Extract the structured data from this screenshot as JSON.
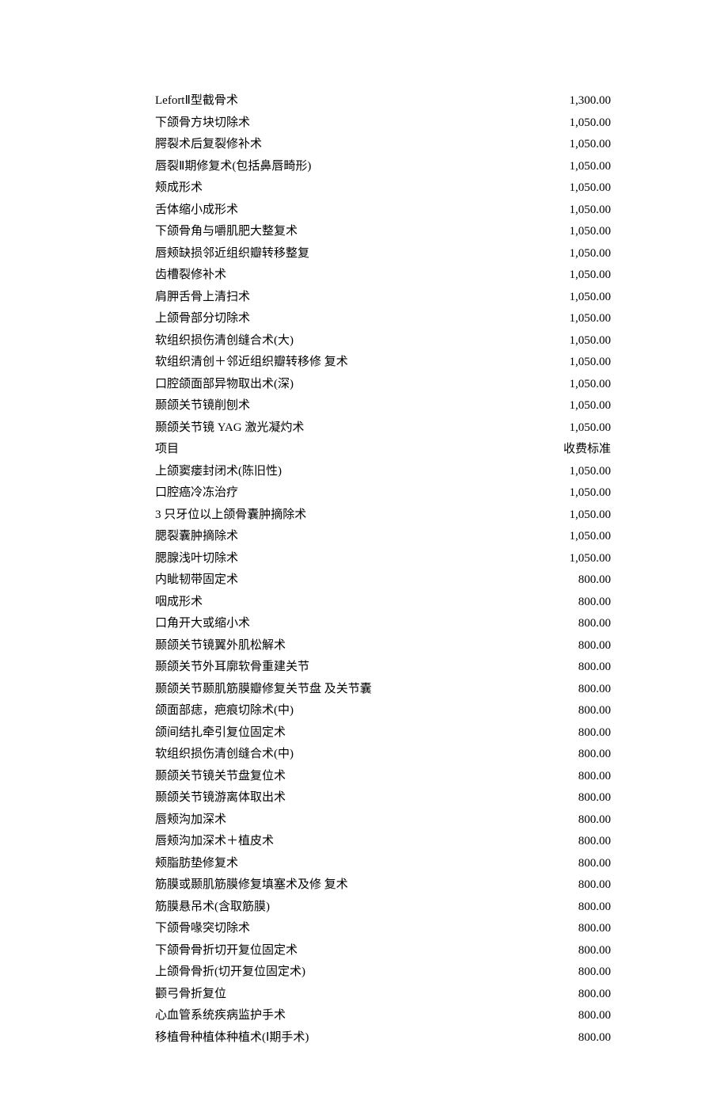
{
  "rows": [
    {
      "name": "LefortⅡ型截骨术",
      "price": "1,300.00"
    },
    {
      "name": "下颌骨方块切除术",
      "price": "1,050.00"
    },
    {
      "name": "腭裂术后复裂修补术",
      "price": "1,050.00"
    },
    {
      "name": "唇裂Ⅱ期修复术(包括鼻唇畸形)",
      "price": "1,050.00"
    },
    {
      "name": "颊成形术",
      "price": "1,050.00"
    },
    {
      "name": "舌体缩小成形术",
      "price": "1,050.00"
    },
    {
      "name": "下颌骨角与嚼肌肥大整复术",
      "price": "1,050.00"
    },
    {
      "name": "唇颊缺损邻近组织瓣转移整复",
      "price": "1,050.00"
    },
    {
      "name": "齿槽裂修补术",
      "price": "1,050.00"
    },
    {
      "name": "肩胛舌骨上清扫术",
      "price": "1,050.00"
    },
    {
      "name": "上颌骨部分切除术",
      "price": "1,050.00"
    },
    {
      "name": "软组织损伤清创缝合术(大)",
      "price": "1,050.00"
    },
    {
      "name": "软组织清创＋邻近组织瓣转移修  复术",
      "price": "1,050.00"
    },
    {
      "name": "口腔颌面部异物取出术(深)",
      "price": "1,050.00"
    },
    {
      "name": "颞颌关节镜削刨术",
      "price": "1,050.00"
    },
    {
      "name": "颞颌关节镜 YAG 激光凝灼术",
      "price": "1,050.00"
    },
    {
      "name": "项目",
      "price": "收费标准"
    },
    {
      "name": "上颌窦瘘封闭术(陈旧性)",
      "price": "1,050.00"
    },
    {
      "name": "口腔癌冷冻治疗",
      "price": "1,050.00"
    },
    {
      "name": "3 只牙位以上颌骨囊肿摘除术",
      "price": "1,050.00"
    },
    {
      "name": "腮裂囊肿摘除术",
      "price": "1,050.00"
    },
    {
      "name": "腮腺浅叶切除术",
      "price": "1,050.00"
    },
    {
      "name": "内眦韧带固定术",
      "price": "800.00"
    },
    {
      "name": "咽成形术",
      "price": "800.00"
    },
    {
      "name": "口角开大或缩小术",
      "price": "800.00"
    },
    {
      "name": "颞颌关节镜翼外肌松解术",
      "price": "800.00"
    },
    {
      "name": "颞颌关节外耳廓软骨重建关节",
      "price": "800.00"
    },
    {
      "name": "颞颌关节颞肌筋膜瓣修复关节盘  及关节囊",
      "price": "800.00"
    },
    {
      "name": "颌面部痣，疤痕切除术(中)",
      "price": "800.00"
    },
    {
      "name": "颌间结扎牵引复位固定术",
      "price": "800.00"
    },
    {
      "name": "软组织损伤清创缝合术(中)",
      "price": "800.00"
    },
    {
      "name": "颞颌关节镜关节盘复位术",
      "price": "800.00"
    },
    {
      "name": "颞颌关节镜游离体取出术",
      "price": "800.00"
    },
    {
      "name": "唇颊沟加深术",
      "price": "800.00"
    },
    {
      "name": "唇颊沟加深术＋植皮术",
      "price": "800.00"
    },
    {
      "name": "颊脂肪垫修复术",
      "price": "800.00"
    },
    {
      "name": "筋膜或颞肌筋膜修复填塞术及修  复术",
      "price": "800.00"
    },
    {
      "name": "筋膜悬吊术(含取筋膜)",
      "price": "800.00"
    },
    {
      "name": "下颌骨喙突切除术",
      "price": "800.00"
    },
    {
      "name": "下颌骨骨折切开复位固定术",
      "price": "800.00"
    },
    {
      "name": "上颌骨骨折(切开复位固定术)",
      "price": "800.00"
    },
    {
      "name": "颧弓骨折复位",
      "price": "800.00"
    },
    {
      "name": "心血管系统疾病监护手术",
      "price": "800.00"
    },
    {
      "name": "移植骨种植体种植术(Ⅰ期手术)",
      "price": "800.00"
    }
  ]
}
